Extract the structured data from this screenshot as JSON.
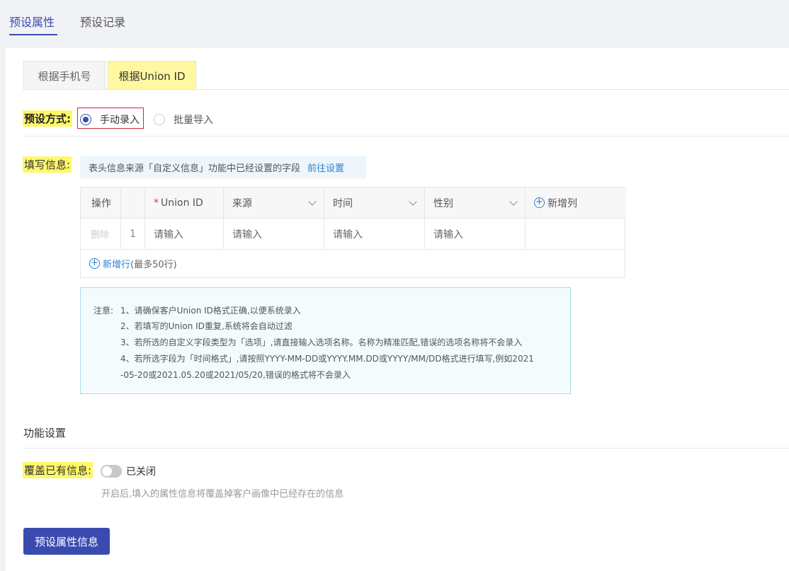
{
  "top_tabs": [
    {
      "label": "预设属性",
      "active": true
    },
    {
      "label": "预设记录",
      "active": false
    }
  ],
  "sub_tabs": [
    {
      "label": "根据手机号",
      "active": false
    },
    {
      "label": "根据Union ID",
      "active": true
    }
  ],
  "preset_mode": {
    "label": "预设方式:",
    "options": [
      {
        "label": "手动录入",
        "checked": true
      },
      {
        "label": "批量导入",
        "checked": false
      }
    ]
  },
  "fill_info": {
    "label": "填写信息:",
    "tip": "表头信息来源「自定义信息」功能中已经设置的字段",
    "tip_link": "前往设置"
  },
  "table": {
    "headers": {
      "action": "操作",
      "index": "",
      "required_mark": "*",
      "union_id": "Union ID",
      "source": "来源",
      "time": "时间",
      "gender": "性别",
      "add_column": "新增列"
    },
    "rows": [
      {
        "delete": "删除",
        "index": "1",
        "union_id": "请输入",
        "source": "请输入",
        "time": "请输入",
        "gender": "请输入"
      }
    ],
    "add_row": "新增行",
    "add_row_limit": "(最多50行)"
  },
  "notes": {
    "prefix": "注意:",
    "lines": [
      "1、请确保客户Union ID格式正确,以便系统录入",
      "2、若填写的Union ID重复,系统将会自动过滤",
      "3、若所选的自定义字段类型为「选项」,请直接输入选项名称。名称为精准匹配,错误的选项名称将不会录入",
      "4、若所选字段为「时间格式」,请按照YYYY-MM-DD或YYYY.MM.DD或YYYY/MM/DD格式进行填写,例如2021",
      "-05-20或2021.05.20或2021/05/20,错误的格式将不会录入"
    ]
  },
  "function_settings": {
    "title": "功能设置",
    "overwrite_label": "覆盖已有信息:",
    "toggle_state": "已关闭",
    "toggle_on": false,
    "help": "开启后,填入的属性信息将覆盖掉客户画像中已经存在的信息"
  },
  "submit_button": "预设属性信息",
  "colors": {
    "primary": "#3a4bb0",
    "link": "#2b7fd0",
    "highlight": "#fff86a",
    "radio_box_border": "#c8283a"
  }
}
